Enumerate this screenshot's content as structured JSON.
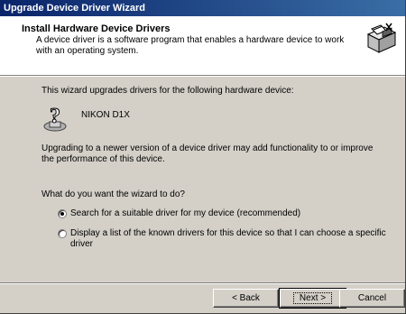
{
  "window": {
    "title": "Upgrade Device Driver Wizard"
  },
  "header": {
    "title": "Install Hardware Device Drivers",
    "subtitle": "A device driver is a software program that enables a hardware device to work with an operating system.",
    "icon": "hardware-install-icon"
  },
  "main": {
    "intro": "This wizard upgrades drivers for the following hardware device:",
    "device_name": "NIKON D1X",
    "device_icon": "unknown-device-question-icon",
    "upgrade_note": "Upgrading to a newer version of a device driver may add functionality to or improve the performance of this device.",
    "question": "What do you want the wizard to do?",
    "options": [
      {
        "label": "Search for a suitable driver for my device (recommended)",
        "selected": true
      },
      {
        "label": "Display a list of the known drivers for this device so that I can choose a specific driver",
        "selected": false
      }
    ]
  },
  "buttons": {
    "back": "< Back",
    "next": "Next >",
    "cancel": "Cancel"
  }
}
